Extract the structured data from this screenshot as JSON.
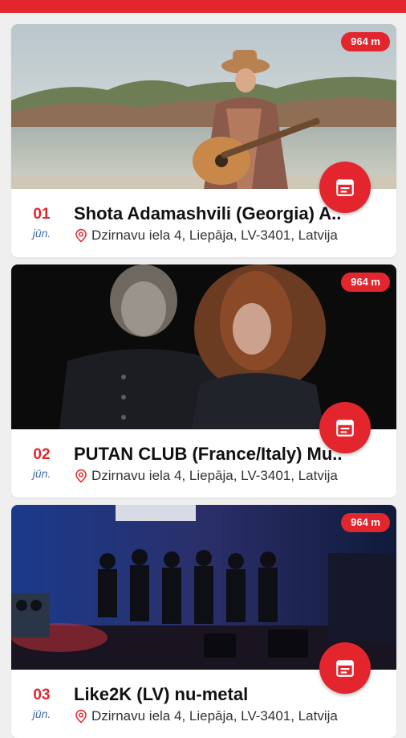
{
  "header": {
    "color": "#e3262d"
  },
  "events": [
    {
      "day": "01",
      "month": "jūn.",
      "title": "Shota Adamashvili (Georgia) A..",
      "address": "Dzirnavu iela 4, Liepāja, LV-3401, Latvija",
      "distance": "964 m"
    },
    {
      "day": "02",
      "month": "jūn.",
      "title": "PUTAN CLUB (France/Italy) Mu..",
      "address": "Dzirnavu iela 4, Liepāja, LV-3401, Latvija",
      "distance": "964 m"
    },
    {
      "day": "03",
      "month": "jūn.",
      "title": "Like2K (LV) nu-metal",
      "address": "Dzirnavu iela 4, Liepāja, LV-3401, Latvija",
      "distance": "964 m"
    }
  ],
  "icons": {
    "calendar": "calendar-icon",
    "location": "location-pin-icon"
  },
  "colors": {
    "accent": "#e3262d",
    "month": "#3d6fb5"
  }
}
